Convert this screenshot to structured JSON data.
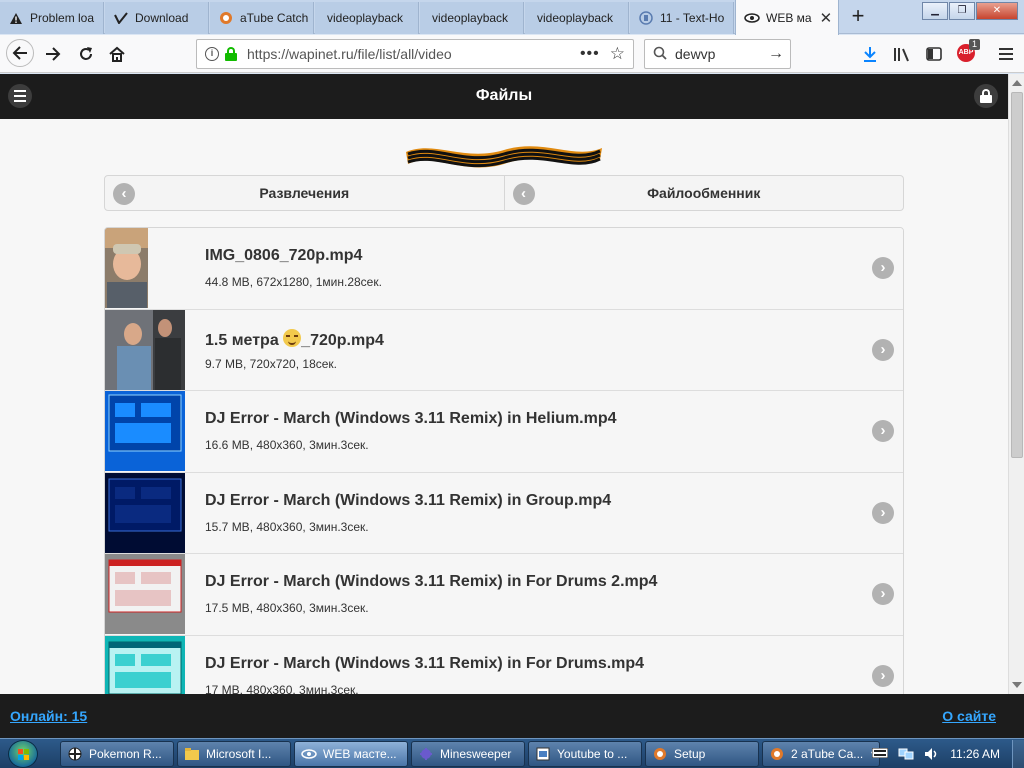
{
  "browser": {
    "tabs": [
      {
        "title": "Problem loa",
        "icon": "warning-icon"
      },
      {
        "title": "Download",
        "icon": "vimeo-icon"
      },
      {
        "title": "aTube Catch",
        "icon": "atube-icon"
      },
      {
        "title": "videoplayback",
        "icon": ""
      },
      {
        "title": "videoplayback",
        "icon": ""
      },
      {
        "title": "videoplayback",
        "icon": ""
      },
      {
        "title": "11 - Text-Ho",
        "icon": "page-icon"
      },
      {
        "title": "WEB ма",
        "icon": "eye-icon",
        "active": true
      }
    ],
    "url": "https://wapinet.ru/file/list/all/video",
    "search_text": "dewvp",
    "addon_badge": "1",
    "addon_label": "ABP"
  },
  "page": {
    "title": "Файлы",
    "breadcrumbs": [
      {
        "label": "Развлечения"
      },
      {
        "label": "Файлообменник"
      }
    ],
    "files": [
      {
        "name": "IMG_0806_720p.mp4",
        "meta": "44.8 MB, 672x1280, 1мин.28сек."
      },
      {
        "name_before": "1.5 метра ",
        "name_after": "_720p.mp4",
        "meta": "9.7 MB, 720x720, 18сек."
      },
      {
        "name": "DJ Error - March (Windows 3.11 Remix) in Helium.mp4",
        "meta": "16.6 MB, 480x360, 3мин.3сек."
      },
      {
        "name": "DJ Error - March (Windows 3.11 Remix) in Group.mp4",
        "meta": "15.7 MB, 480x360, 3мин.3сек."
      },
      {
        "name": "DJ Error - March (Windows 3.11 Remix) in For Drums 2.mp4",
        "meta": "17.5 MB, 480x360, 3мин.3сек."
      },
      {
        "name": "DJ Error - March (Windows 3.11 Remix) in For Drums.mp4",
        "meta": "17 MB, 480x360, 3мин.3сек."
      }
    ],
    "footer": {
      "online": "Онлайн: 15",
      "about": "О сайте"
    }
  },
  "taskbar": {
    "items": [
      {
        "label": "Pokemon R...",
        "icon": "pokemon-icon"
      },
      {
        "label": "Microsoft I...",
        "icon": "folder-icon"
      },
      {
        "label": "WEB масте...",
        "icon": "eye-icon",
        "active": true
      },
      {
        "label": "Minesweeper",
        "icon": "mine-icon"
      },
      {
        "label": "Youtube to ...",
        "icon": "app-icon"
      },
      {
        "label": "Setup",
        "icon": "atube-icon"
      },
      {
        "label": "2 aTube Ca...",
        "icon": "atube-icon"
      }
    ],
    "clock": "11:26 AM"
  },
  "colors": {
    "header_bg": "#1c1c1c",
    "link": "#35a7ff",
    "secure_lock": "#12bc00"
  }
}
